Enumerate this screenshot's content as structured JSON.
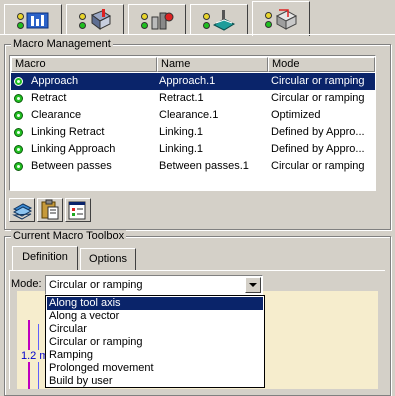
{
  "toolbar_tabs": [
    {
      "icon": "tool-axis-icon"
    },
    {
      "icon": "tool-geometry-icon"
    },
    {
      "icon": "feeds-speeds-icon"
    },
    {
      "icon": "strategy-icon"
    },
    {
      "icon": "macro-icon",
      "active": true
    }
  ],
  "macro_management": {
    "title": "Macro Management",
    "columns": [
      "Macro",
      "Name",
      "Mode"
    ],
    "rows": [
      {
        "macro": "Approach",
        "name": "Approach.1",
        "mode": "Circular or ramping",
        "selected": true
      },
      {
        "macro": "Retract",
        "name": "Retract.1",
        "mode": "Circular or ramping"
      },
      {
        "macro": "Clearance",
        "name": "Clearance.1",
        "mode": "Optimized"
      },
      {
        "macro": "Linking Retract",
        "name": "Linking.1",
        "mode": "Defined by Appro..."
      },
      {
        "macro": "Linking Approach",
        "name": "Linking.1",
        "mode": "Defined by Appro..."
      },
      {
        "macro": "Between passes",
        "name": "Between passes.1",
        "mode": "Circular or ramping"
      }
    ],
    "buttons": [
      "copy-icon",
      "paste-icon",
      "properties-icon"
    ]
  },
  "toolbox": {
    "title": "Current Macro Toolbox",
    "tabs": [
      "Definition",
      "Options"
    ],
    "mode_label": "Mode:",
    "mode_value": "Circular or ramping",
    "options": [
      "Along tool axis",
      "Along a vector",
      "Circular",
      "Circular or ramping",
      "Ramping",
      "Prolonged movement",
      "Build by user"
    ],
    "highlighted_option": "Along tool axis",
    "preview_dimension": "1.2 m"
  },
  "colors": {
    "selection": "#0a246a",
    "status_led": "#22c022",
    "preview_bg": "#f6edcd",
    "preview_line": "#c000c0",
    "dimension_text": "#0000cc"
  }
}
